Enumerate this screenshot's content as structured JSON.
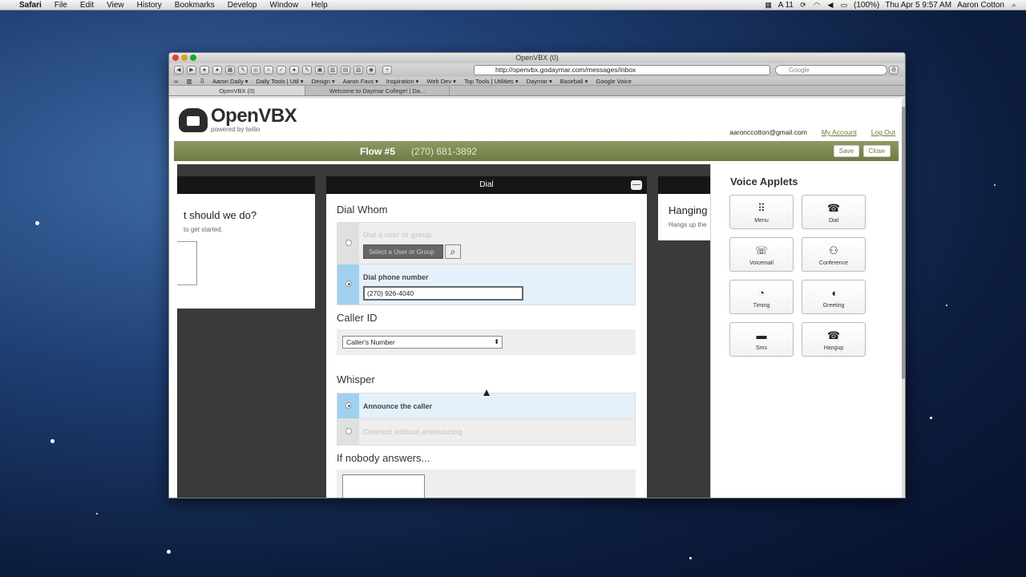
{
  "menubar": {
    "app": "Safari",
    "items": [
      "File",
      "Edit",
      "View",
      "History",
      "Bookmarks",
      "Develop",
      "Window",
      "Help"
    ],
    "status": {
      "battery": "(100%)",
      "datetime": "Thu Apr 5  9:57 AM",
      "user": "Aaron Cotton",
      "adobe_count": "11"
    }
  },
  "browser": {
    "title": "OpenVBX (0)",
    "url": "http://openvbx.godaymar.com/messages/inbox",
    "search_placeholder": "Google",
    "bookmarks": [
      "Aaron Daily ▾",
      "Daily Tools | Util ▾",
      "Design ▾",
      "Aaron Favs ▾",
      "Inspiration ▾",
      "Web Dev ▾",
      "Top Tools | Utilities ▾",
      "Daymar ▾",
      "Baseball ▾",
      "Google Voice"
    ],
    "tabs": [
      {
        "label": "OpenVBX (0)"
      },
      {
        "label": "Welcome to Daymar College! | Da..."
      }
    ]
  },
  "app": {
    "logo_text": "OpenVBX",
    "logo_sub": "powered by twilio",
    "user_email": "aaronccotton@gmail.com",
    "my_account": "My Account",
    "log_out": "Log Out",
    "flow_name": "Flow #5",
    "flow_number": "(270) 681-3892",
    "save_label": "Save",
    "close_label": "Close"
  },
  "left_panel": {
    "question": "t should we do?",
    "subtext": "to get started."
  },
  "dial_panel": {
    "title": "Dial",
    "collapse_glyph": "—",
    "dial_whom": "Dial Whom",
    "opt_user_group": "Dial a user or group",
    "select_placeholder": "Select a User or Group",
    "opt_phone": "Dial phone number",
    "phone_value": "(270) 926-4040",
    "caller_id_title": "Caller ID",
    "caller_id_value": "Caller's Number",
    "whisper_title": "Whisper",
    "whisper_announce": "Announce the caller",
    "whisper_connect": "Connect without announcing",
    "nobody_title": "If nobody answers..."
  },
  "right_panel": {
    "title": "Hanging",
    "subtext": "Hangs up the"
  },
  "applets": {
    "title": "Voice Applets",
    "items": [
      {
        "label": "Menu",
        "icon": "⠿"
      },
      {
        "label": "Dial",
        "icon": "☎"
      },
      {
        "label": "Voicemail",
        "icon": "☏"
      },
      {
        "label": "Conference",
        "icon": "⚇"
      },
      {
        "label": "Timing",
        "icon": "◔"
      },
      {
        "label": "Greeting",
        "icon": "◖"
      },
      {
        "label": "Sms",
        "icon": "▬"
      },
      {
        "label": "Hangup",
        "icon": "☎"
      }
    ]
  }
}
